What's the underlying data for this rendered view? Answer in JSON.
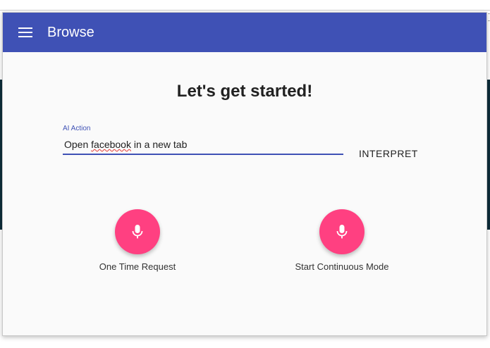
{
  "app": {
    "title": "Browse"
  },
  "main": {
    "heading": "Let's get started!",
    "action_field": {
      "label": "AI Action",
      "value": "Open facebook in a new tab",
      "value_parts": [
        "Open ",
        "facebook",
        " in a new tab"
      ]
    },
    "interpret_label": "INTERPRET",
    "one_time": {
      "label": "One Time Request"
    },
    "continuous": {
      "label": "Start Continuous Mode"
    }
  },
  "colors": {
    "appbar": "#3f51b5",
    "accent": "#ff4081",
    "background": "#fafafa",
    "page_band": "#0d2d3a"
  },
  "icons": {
    "menu": "menu-icon",
    "mic": "microphone-icon"
  }
}
